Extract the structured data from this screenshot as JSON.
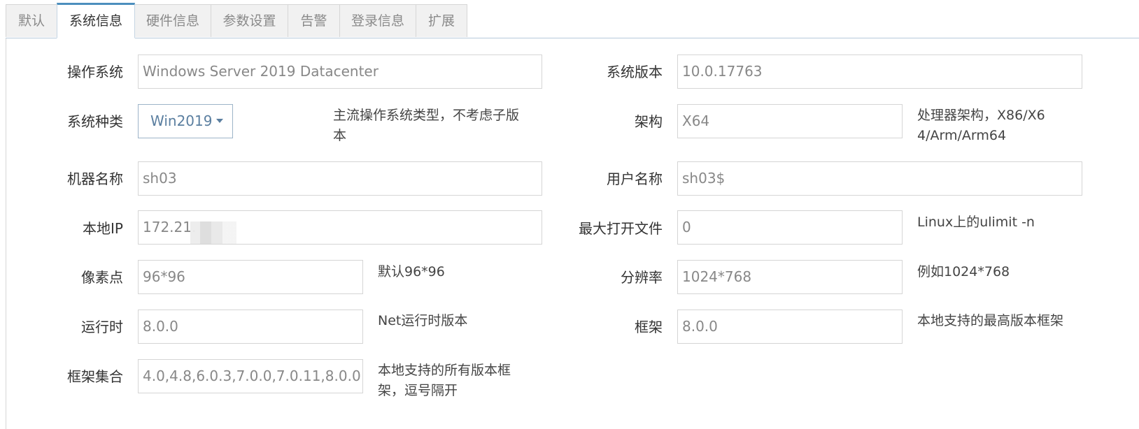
{
  "tabs": [
    {
      "label": "默认"
    },
    {
      "label": "系统信息"
    },
    {
      "label": "硬件信息"
    },
    {
      "label": "参数设置"
    },
    {
      "label": "告警"
    },
    {
      "label": "登录信息"
    },
    {
      "label": "扩展"
    }
  ],
  "active_tab": "系统信息",
  "form": {
    "os": {
      "label": "操作系统",
      "value": "Windows Server 2019 Datacenter"
    },
    "os_version": {
      "label": "系统版本",
      "value": "10.0.17763"
    },
    "os_kind": {
      "label": "系统种类",
      "value": "Win2019",
      "help": "主流操作系统类型，不考虑子版本"
    },
    "arch": {
      "label": "架构",
      "value": "X64",
      "help": "处理器架构，X86/X64/Arm/Arm64"
    },
    "machine_name": {
      "label": "机器名称",
      "value": "sh03"
    },
    "user_name": {
      "label": "用户名称",
      "value": "sh03$"
    },
    "local_ip": {
      "label": "本地IP",
      "value": "172.21."
    },
    "max_open_files": {
      "label": "最大打开文件",
      "value": "0",
      "help": "Linux上的ulimit -n"
    },
    "dpi": {
      "label": "像素点",
      "value": "96*96",
      "help": "默认96*96"
    },
    "resolution": {
      "label": "分辨率",
      "value": "1024*768",
      "help": "例如1024*768"
    },
    "runtime": {
      "label": "运行时",
      "value": "8.0.0",
      "help": "Net运行时版本"
    },
    "framework": {
      "label": "框架",
      "value": "8.0.0",
      "help": "本地支持的最高版本框架"
    },
    "frameworks": {
      "label": "框架集合",
      "value": "4.0,4.8,6.0.3,7.0.0,7.0.11,8.0.0",
      "help": "本地支持的所有版本框架，逗号隔开"
    }
  },
  "colors": {
    "active_tab_border": "#4c8fbd",
    "select_text": "#5b7fa0"
  }
}
